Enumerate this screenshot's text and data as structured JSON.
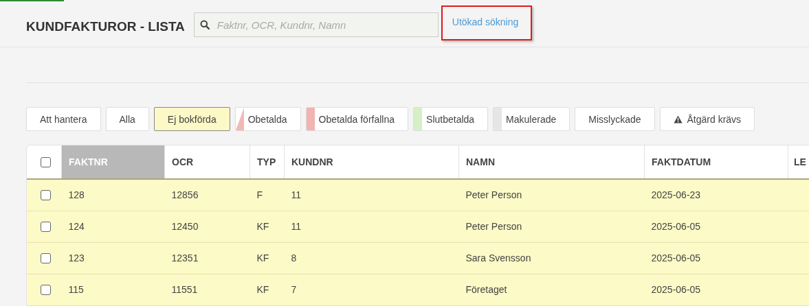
{
  "header": {
    "title": "KUNDFAKTUROR - LISTA",
    "search": {
      "placeholder": "Faktnr, OCR, Kundnr, Namn"
    },
    "advanced_link": {
      "label": "Utökad sökning",
      "highlighted": true
    }
  },
  "filters": [
    {
      "label": "Att hantera",
      "kind": "plain",
      "selected": false
    },
    {
      "label": "Alla",
      "kind": "plain",
      "selected": false
    },
    {
      "label": "Ej bokförda",
      "kind": "plain",
      "selected": true
    },
    {
      "label": "Obetalda",
      "kind": "triangle",
      "color": "#f2b8b8",
      "selected": false
    },
    {
      "label": "Obetalda förfallna",
      "kind": "stripe",
      "color": "#f2b3b3",
      "selected": false
    },
    {
      "label": "Slutbetalda",
      "kind": "stripe",
      "color": "#d4f0c4",
      "selected": false
    },
    {
      "label": "Makulerade",
      "kind": "stripe",
      "color": "#e6e6e6",
      "selected": false
    },
    {
      "label": "Misslyckade",
      "kind": "plain",
      "selected": false
    },
    {
      "label": "Åtgärd krävs",
      "kind": "warning",
      "selected": false
    }
  ],
  "table": {
    "select_all": {
      "checked": false
    },
    "columns": [
      {
        "label": "FAKTNR",
        "sorted": true
      },
      {
        "label": "OCR",
        "sorted": false
      },
      {
        "label": "TYP",
        "sorted": false
      },
      {
        "label": "KUNDNR",
        "sorted": false
      },
      {
        "label": "NAMN",
        "sorted": false
      },
      {
        "label": "FAKTDATUM",
        "sorted": false
      },
      {
        "label": "LE",
        "sorted": false
      }
    ],
    "rows": [
      {
        "checked": false,
        "cells": [
          "128",
          "12856",
          "F",
          "11",
          "Peter Person",
          "2025-06-23"
        ]
      },
      {
        "checked": false,
        "cells": [
          "124",
          "12450",
          "KF",
          "11",
          "Peter Person",
          "2025-06-05"
        ]
      },
      {
        "checked": false,
        "cells": [
          "123",
          "12351",
          "KF",
          "8",
          "Sara Svensson",
          "2025-06-05"
        ]
      },
      {
        "checked": false,
        "cells": [
          "115",
          "11551",
          "KF",
          "7",
          "Företaget",
          "2025-06-05"
        ]
      }
    ]
  }
}
